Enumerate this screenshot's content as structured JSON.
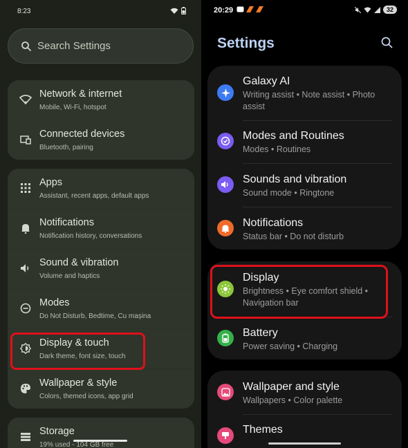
{
  "left": {
    "status": {
      "time": "8:23"
    },
    "search": {
      "placeholder": "Search Settings"
    },
    "items": [
      {
        "title": "Network & internet",
        "subtitle": "Mobile, Wi‑Fi, hotspot",
        "icon": "wifi-icon"
      },
      {
        "title": "Connected devices",
        "subtitle": "Bluetooth, pairing",
        "icon": "devices-icon"
      },
      {
        "title": "Apps",
        "subtitle": "Assistant, recent apps, default apps",
        "icon": "apps-grid-icon"
      },
      {
        "title": "Notifications",
        "subtitle": "Notification history, conversations",
        "icon": "bell-icon"
      },
      {
        "title": "Sound & vibration",
        "subtitle": "Volume and haptics",
        "icon": "speaker-icon"
      },
      {
        "title": "Modes",
        "subtitle": "Do Not Disturb, Bedtime, Cu mașina",
        "icon": "modes-icon"
      },
      {
        "title": "Display & touch",
        "subtitle": "Dark theme, font size, touch",
        "icon": "display-brightness-icon"
      },
      {
        "title": "Wallpaper & style",
        "subtitle": "Colors, themed icons, app grid",
        "icon": "palette-icon"
      },
      {
        "title": "Storage",
        "subtitle": "19% used - 104 GB free",
        "icon": "storage-icon"
      }
    ]
  },
  "right": {
    "status": {
      "time": "20:29",
      "battery": "32"
    },
    "header": {
      "title": "Settings"
    },
    "items": [
      {
        "title": "Galaxy AI",
        "subtitle": "Writing assist  •  Note assist  •  Photo assist",
        "icon": "galaxy-ai-icon",
        "color": "#3e7bf2"
      },
      {
        "title": "Modes and Routines",
        "subtitle": "Modes  •  Routines",
        "icon": "modes-routines-icon",
        "color": "#7a5cf0"
      },
      {
        "title": "Sounds and vibration",
        "subtitle": "Sound mode  •  Ringtone",
        "icon": "sound-icon",
        "color": "#7c5cf2"
      },
      {
        "title": "Notifications",
        "subtitle": "Status bar  •  Do not disturb",
        "icon": "notification-icon",
        "color": "#f06a2a"
      },
      {
        "title": "Display",
        "subtitle": "Brightness  •  Eye comfort shield  •  Navigation bar",
        "icon": "sun-icon",
        "color": "#8cc63a"
      },
      {
        "title": "Battery",
        "subtitle": "Power saving  •  Charging",
        "icon": "battery-icon",
        "color": "#36b04a"
      },
      {
        "title": "Wallpaper and style",
        "subtitle": "Wallpapers  •  Color palette",
        "icon": "wallpaper-icon",
        "color": "#e54a7a"
      },
      {
        "title": "Themes",
        "subtitle": "",
        "icon": "themes-icon",
        "color": "#e54a7a"
      }
    ]
  }
}
